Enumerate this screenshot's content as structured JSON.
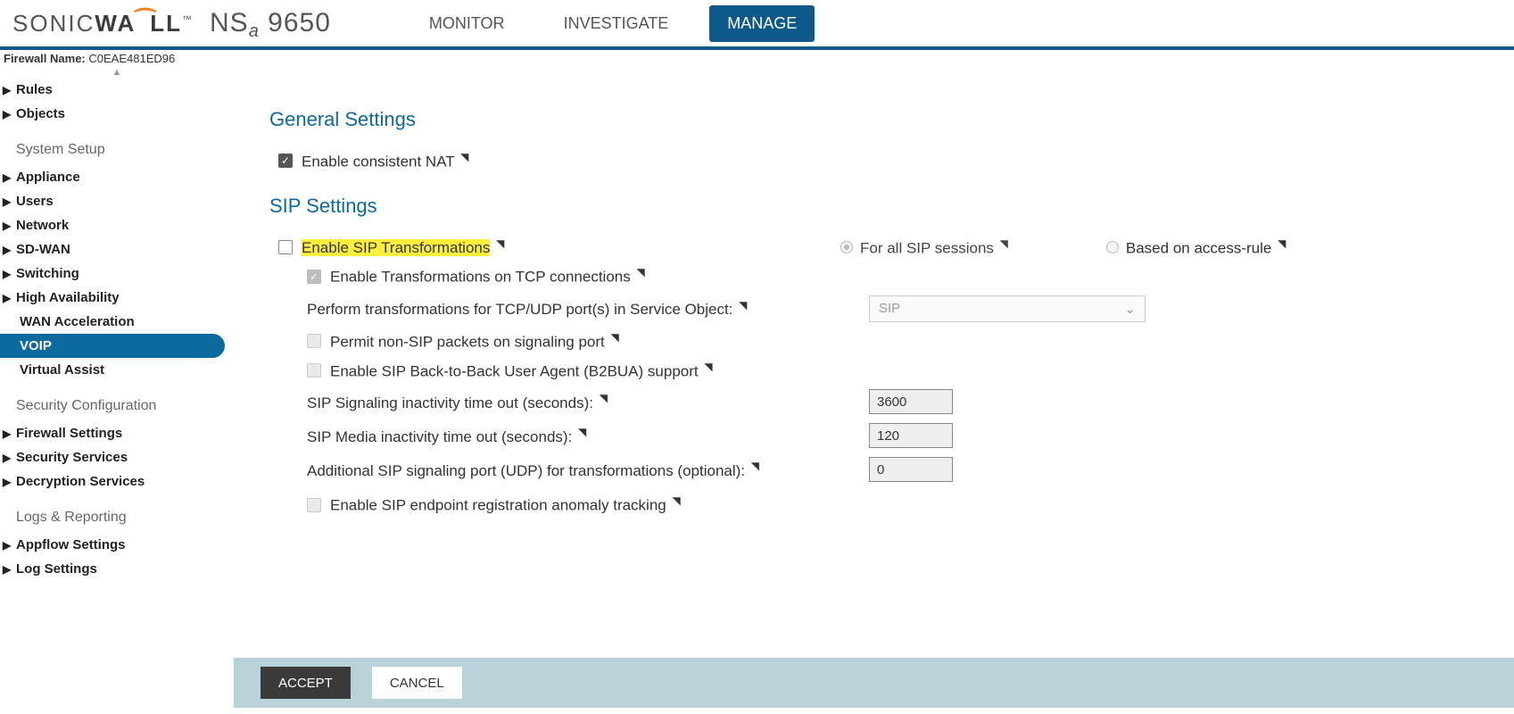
{
  "brand": {
    "left": "SONIC",
    "mid": "WA",
    "right": "LL",
    "tm": "™"
  },
  "model": {
    "prefix": "NS",
    "sub": "a",
    "suffix": " 9650"
  },
  "nav": {
    "monitor": "MONITOR",
    "investigate": "INVESTIGATE",
    "manage": "MANAGE"
  },
  "firewall_name": {
    "label": "Firewall Name:",
    "value": "C0EAE481ED96"
  },
  "sidebar": {
    "top_items": [
      {
        "label": "Rules"
      },
      {
        "label": "Objects"
      }
    ],
    "groups": [
      {
        "title": "System Setup",
        "items": [
          {
            "label": "Appliance",
            "arrow": true
          },
          {
            "label": "Users",
            "arrow": true
          },
          {
            "label": "Network",
            "arrow": true
          },
          {
            "label": "SD-WAN",
            "arrow": true
          },
          {
            "label": "Switching",
            "arrow": true
          },
          {
            "label": "High Availability",
            "arrow": true
          },
          {
            "label": "WAN Acceleration",
            "arrow": false
          },
          {
            "label": "VOIP",
            "arrow": false,
            "active": true
          },
          {
            "label": "Virtual Assist",
            "arrow": false
          }
        ]
      },
      {
        "title": "Security Configuration",
        "items": [
          {
            "label": "Firewall Settings",
            "arrow": true
          },
          {
            "label": "Security Services",
            "arrow": true
          },
          {
            "label": "Decryption Services",
            "arrow": true
          }
        ]
      },
      {
        "title": "Logs & Reporting",
        "items": [
          {
            "label": "Appflow Settings",
            "arrow": true
          },
          {
            "label": "Log Settings",
            "arrow": true
          }
        ]
      }
    ]
  },
  "main": {
    "general": {
      "heading": "General Settings",
      "consistent_nat": {
        "label": "Enable consistent NAT",
        "checked": true
      }
    },
    "sip": {
      "heading": "SIP Settings",
      "enable_transform": {
        "label": "Enable SIP Transformations",
        "checked": false
      },
      "radio_all": "For all SIP sessions",
      "radio_rule": "Based on access-rule",
      "tcp_transform": {
        "label": "Enable Transformations on TCP connections",
        "checked": true,
        "disabled": true
      },
      "svc_obj": {
        "label": "Perform transformations for TCP/UDP port(s) in Service Object:",
        "value": "SIP"
      },
      "permit_non_sip": {
        "label": "Permit non-SIP packets on signaling port",
        "checked": false
      },
      "b2bua": {
        "label": "Enable SIP Back-to-Back User Agent (B2BUA) support",
        "checked": false
      },
      "sig_timeout": {
        "label": "SIP Signaling inactivity time out (seconds):",
        "value": "3600"
      },
      "media_timeout": {
        "label": "SIP Media inactivity time out (seconds):",
        "value": "120"
      },
      "add_port": {
        "label": "Additional SIP signaling port (UDP) for transformations (optional):",
        "value": "0"
      },
      "anomaly": {
        "label": "Enable SIP endpoint registration anomaly tracking",
        "checked": false
      }
    },
    "buttons": {
      "accept": "ACCEPT",
      "cancel": "CANCEL"
    }
  }
}
